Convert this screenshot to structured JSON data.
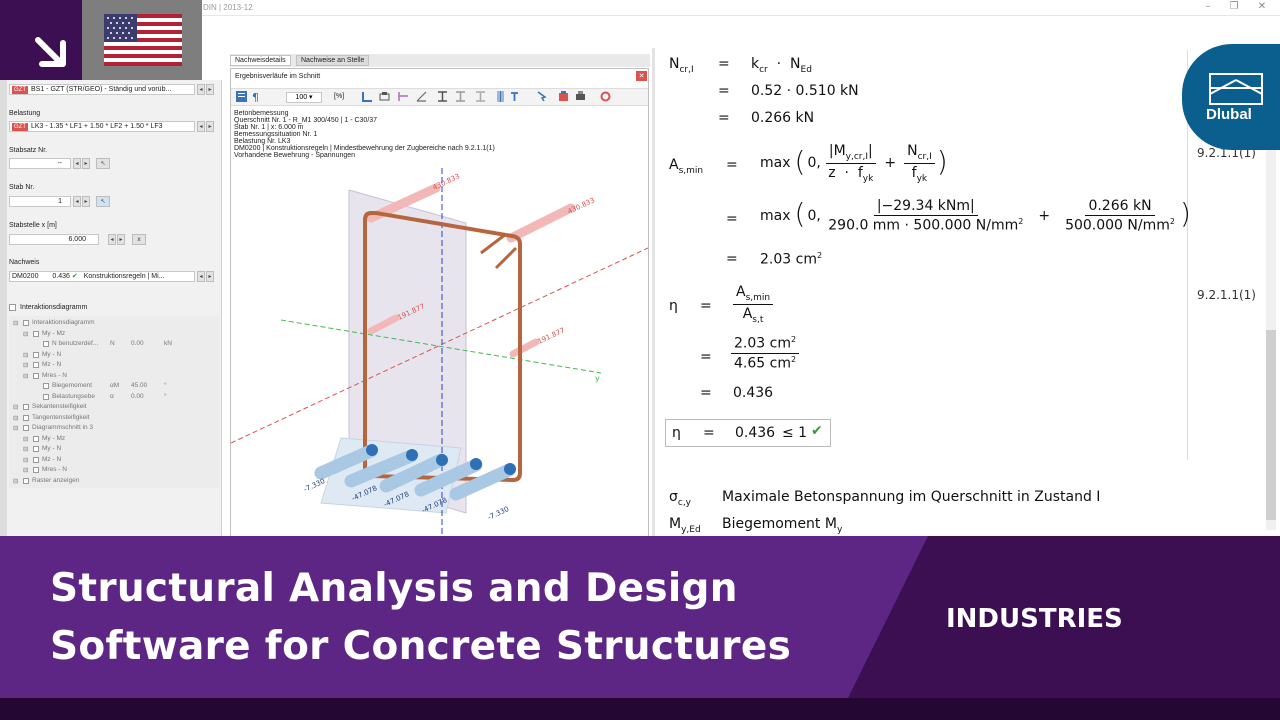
{
  "window": {
    "title": "DIN | 2013-12"
  },
  "left": {
    "combo1": {
      "tag": "GZT",
      "text": "BS1 - GZT (STR/GEO) - Ständig und vorüb..."
    },
    "belastung_label": "Belastung",
    "combo2": {
      "tag": "GZT",
      "text": "LK3 - 1.35 * LF1 + 1.50 * LF2 + 1.50 * LF3"
    },
    "stabsatz_label": "Stabsatz Nr.",
    "stabsatz_value": "--",
    "stab_label": "Stab Nr.",
    "stab_value": "1",
    "stabstelle_label": "Stabstelle x [m]",
    "stabstelle_value": "6.000",
    "nachweis_label": "Nachweis",
    "nachweis": {
      "id": "DM0200",
      "ratio": "0.436",
      "text": "Konstruktionsregeln | Mi..."
    },
    "interaktion_label": "Interaktionsdiagramm",
    "tree": [
      {
        "label": "Interaktionsdiagramm",
        "level": 0,
        "u": "",
        "v": "",
        "unit": ""
      },
      {
        "label": "My - Mz",
        "level": 1,
        "u": "",
        "v": "",
        "unit": ""
      },
      {
        "label": "N benutzerdef...",
        "level": 2,
        "u": "N",
        "v": "0.00",
        "unit": "kN"
      },
      {
        "label": "My - N",
        "level": 1,
        "u": "",
        "v": "",
        "unit": ""
      },
      {
        "label": "Mz - N",
        "level": 1,
        "u": "",
        "v": "",
        "unit": ""
      },
      {
        "label": "Mres - N",
        "level": 1,
        "u": "",
        "v": "",
        "unit": ""
      },
      {
        "label": "Biegemoment",
        "level": 2,
        "u": "αM",
        "v": "45.00",
        "unit": "°"
      },
      {
        "label": "Belastungsebe",
        "level": 2,
        "u": "α",
        "v": "0.00",
        "unit": "°"
      },
      {
        "label": "Sekantensteifigkeit",
        "level": 0,
        "u": "",
        "v": "",
        "unit": ""
      },
      {
        "label": "Tangentensteifigkeit",
        "level": 0,
        "u": "",
        "v": "",
        "unit": ""
      },
      {
        "label": "Diagrammschnitt in 3",
        "level": 0,
        "u": "",
        "v": "",
        "unit": ""
      },
      {
        "label": "My - Mz",
        "level": 1,
        "u": "",
        "v": "",
        "unit": ""
      },
      {
        "label": "My - N",
        "level": 1,
        "u": "",
        "v": "",
        "unit": ""
      },
      {
        "label": "Mz - N",
        "level": 1,
        "u": "",
        "v": "",
        "unit": ""
      },
      {
        "label": "Mres - N",
        "level": 1,
        "u": "",
        "v": "",
        "unit": ""
      },
      {
        "label": "Raster anzeigen",
        "level": 0,
        "u": "",
        "v": "",
        "unit": ""
      }
    ]
  },
  "middle": {
    "tabs": [
      "Nachweisdetails",
      "Nachweise an Stelle"
    ],
    "window_title": "Ergebnisverläufe im Schnitt",
    "zoom": "100",
    "zoom_unit": "[%]",
    "info": [
      "Betonbemessung",
      "Querschnitt Nr. 1 - R_M1 300/450 | 1 - C30/37",
      "Stab Nr. 1 | x: 6.000 m",
      "Bemessungssituation Nr. 1",
      "Belastung Nr. LK3",
      "DM0200 | Konstruktionsregeln | Mindestbewehrung der Zugbereiche nach 9.2.1.1(1)",
      "Vorhandene Bewehrung - Spannungen"
    ],
    "labels": {
      "top1": "430.833",
      "top2": "430.833",
      "mid1": "191.877",
      "mid2": "191.877",
      "b1": "-7.330",
      "b2": "-47.078",
      "b3": "-47.078",
      "b4": "-47.078",
      "b5": "-7.330",
      "axis_y": "y"
    }
  },
  "right": {
    "ncr_lhs": "N",
    "ncr_lhs_sub": "cr,I",
    "ncr_eq1": "k",
    "ncr_eq1b": "cr",
    "ncr_eq1c": "N",
    "ncr_eq1d": "Ed",
    "ncr_eq2": "0.52 · 0.510 kN",
    "ncr_eq3": "0.266 kN",
    "as_lhs": "A",
    "as_lhs_sub": "s,min",
    "as_max": "max",
    "as_res": "2.03 cm",
    "as_frac1_num": "|−29.34 kNm|",
    "as_frac1_den": "290.0 mm · 500.000 N/mm",
    "as_frac2_num": "0.266 kN",
    "as_frac2_den": "500.000 N/mm",
    "ref1": "9.2.1.1(1)",
    "ref2": "9.2.1.1(1)",
    "eta": "η",
    "eta_num": "2.03 cm",
    "eta_den": "4.65 cm",
    "eta_res": "0.436",
    "box_val": "0.436",
    "box_le": "≤ 1",
    "sigma_sym": "σ",
    "sigma_sub": "c,y",
    "sigma_desc": "Maximale Betonspannung im Querschnitt in Zustand I",
    "my_sym": "M",
    "my_sub": "y,Ed",
    "my_desc": "Biegemoment M",
    "my_desc_sub": "y"
  },
  "logo": {
    "text": "Dlubal"
  },
  "banner": {
    "line1": "Structural Analysis and Design",
    "line2": "Software for Concrete Structures",
    "tag": "INDUSTRIES"
  },
  "colors": {
    "purple": "#5d2684",
    "dark_purple": "#3b0f52",
    "dlubal_blue": "#0b5f8f",
    "check_green": "#2e9e3a"
  }
}
